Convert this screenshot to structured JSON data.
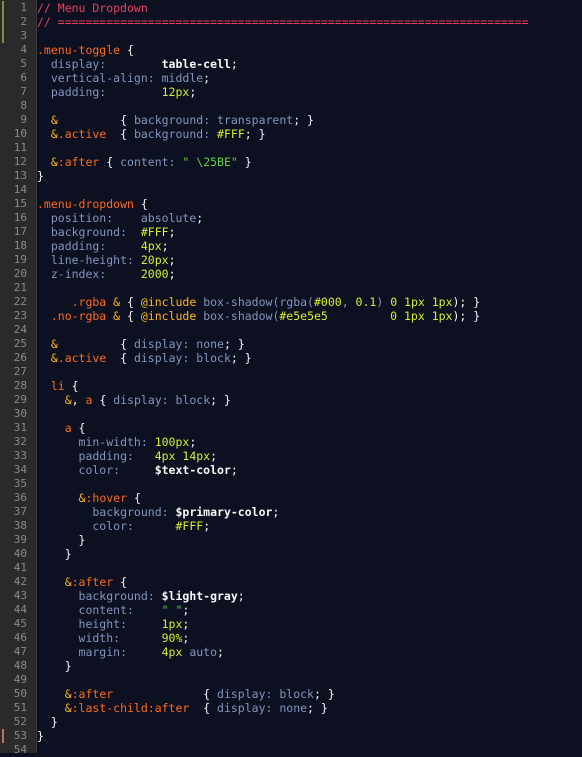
{
  "editor": {
    "gutter_markers": [
      {
        "from_line": 1,
        "to_line": 3,
        "color": "#8a8a3a"
      },
      {
        "from_line": 53,
        "to_line": 53,
        "color": "#c07050"
      }
    ],
    "line_count": 54,
    "lines": [
      [
        [
          "c",
          "// Menu Dropdown"
        ]
      ],
      [
        [
          "c",
          "// ===================================================================="
        ]
      ],
      [],
      [
        [
          "s",
          ".menu-toggle"
        ],
        [
          "w",
          " {"
        ]
      ],
      [
        [
          "p",
          "  display:        "
        ],
        [
          "k",
          "table-cell"
        ],
        [
          "w",
          ";"
        ]
      ],
      [
        [
          "p",
          "  vertical-align: middle"
        ],
        [
          "w",
          ";"
        ]
      ],
      [
        [
          "p",
          "  padding:        "
        ],
        [
          "n",
          "12px"
        ],
        [
          "w",
          ";"
        ]
      ],
      [],
      [
        [
          "a",
          "  &"
        ],
        [
          "w",
          "         { "
        ],
        [
          "p",
          "background: transparent"
        ],
        [
          "w",
          "; }"
        ]
      ],
      [
        [
          "a",
          "  &"
        ],
        [
          "s",
          ".active"
        ],
        [
          "w",
          "  { "
        ],
        [
          "p",
          "background: "
        ],
        [
          "n",
          "#FFF"
        ],
        [
          "w",
          "; }"
        ]
      ],
      [],
      [
        [
          "a",
          "  &"
        ],
        [
          "s",
          ":after"
        ],
        [
          "w",
          " { "
        ],
        [
          "p",
          "content: "
        ],
        [
          "str",
          "\" \\25BE\""
        ],
        [
          "w",
          " }"
        ]
      ],
      [
        [
          "w",
          "}"
        ]
      ],
      [],
      [
        [
          "s",
          ".menu-dropdown"
        ],
        [
          "w",
          " {"
        ]
      ],
      [
        [
          "p",
          "  position:    absolute"
        ],
        [
          "w",
          ";"
        ]
      ],
      [
        [
          "p",
          "  background:  "
        ],
        [
          "n",
          "#FFF"
        ],
        [
          "w",
          ";"
        ]
      ],
      [
        [
          "p",
          "  padding:     "
        ],
        [
          "n",
          "4px"
        ],
        [
          "w",
          ";"
        ]
      ],
      [
        [
          "p",
          "  line-height: "
        ],
        [
          "n",
          "20px"
        ],
        [
          "w",
          ";"
        ]
      ],
      [
        [
          "p",
          "  z-index:     "
        ],
        [
          "n",
          "2000"
        ],
        [
          "w",
          ";"
        ]
      ],
      [],
      [
        [
          "s",
          "     .rgba"
        ],
        [
          "a",
          " &"
        ],
        [
          "w",
          " { "
        ],
        [
          "a",
          "@include"
        ],
        [
          "p",
          " box-shadow(rgba("
        ],
        [
          "n",
          "#000"
        ],
        [
          "p",
          ", "
        ],
        [
          "n",
          "0.1"
        ],
        [
          "p",
          ") "
        ],
        [
          "n",
          "0 1px 1px"
        ],
        [
          "w",
          "); }"
        ]
      ],
      [
        [
          "s",
          "  .no-rgba"
        ],
        [
          "a",
          " &"
        ],
        [
          "w",
          " { "
        ],
        [
          "a",
          "@include"
        ],
        [
          "p",
          " box-shadow("
        ],
        [
          "n",
          "#e5e5e5"
        ],
        [
          "p",
          "         "
        ],
        [
          "n",
          "0 1px 1px"
        ],
        [
          "w",
          "); }"
        ]
      ],
      [],
      [
        [
          "a",
          "  &"
        ],
        [
          "w",
          "         { "
        ],
        [
          "p",
          "display: none"
        ],
        [
          "w",
          "; }"
        ]
      ],
      [
        [
          "a",
          "  &"
        ],
        [
          "s",
          ".active"
        ],
        [
          "w",
          "  { "
        ],
        [
          "p",
          "display: block"
        ],
        [
          "w",
          "; }"
        ]
      ],
      [],
      [
        [
          "s",
          "  li"
        ],
        [
          "w",
          " {"
        ]
      ],
      [
        [
          "a",
          "    &"
        ],
        [
          "w",
          ", "
        ],
        [
          "s",
          "a"
        ],
        [
          "w",
          " { "
        ],
        [
          "p",
          "display: block"
        ],
        [
          "w",
          "; }"
        ]
      ],
      [],
      [
        [
          "s",
          "    a"
        ],
        [
          "w",
          " {"
        ]
      ],
      [
        [
          "p",
          "      min-width: "
        ],
        [
          "n",
          "100px"
        ],
        [
          "w",
          ";"
        ]
      ],
      [
        [
          "p",
          "      padding:   "
        ],
        [
          "n",
          "4px 14px"
        ],
        [
          "w",
          ";"
        ]
      ],
      [
        [
          "p",
          "      color:     "
        ],
        [
          "k",
          "$text-color"
        ],
        [
          "w",
          ";"
        ]
      ],
      [],
      [
        [
          "a",
          "      &"
        ],
        [
          "s",
          ":hover"
        ],
        [
          "w",
          " {"
        ]
      ],
      [
        [
          "p",
          "        background: "
        ],
        [
          "k",
          "$primary-color"
        ],
        [
          "w",
          ";"
        ]
      ],
      [
        [
          "p",
          "        color:      "
        ],
        [
          "n",
          "#FFF"
        ],
        [
          "w",
          ";"
        ]
      ],
      [
        [
          "w",
          "      }"
        ]
      ],
      [
        [
          "w",
          "    }"
        ]
      ],
      [],
      [
        [
          "a",
          "    &"
        ],
        [
          "s",
          ":after"
        ],
        [
          "w",
          " {"
        ]
      ],
      [
        [
          "p",
          "      background: "
        ],
        [
          "k",
          "$light-gray"
        ],
        [
          "w",
          ";"
        ]
      ],
      [
        [
          "p",
          "      content:    "
        ],
        [
          "str",
          "\" \""
        ],
        [
          "w",
          ";"
        ]
      ],
      [
        [
          "p",
          "      height:     "
        ],
        [
          "n",
          "1px"
        ],
        [
          "w",
          ";"
        ]
      ],
      [
        [
          "p",
          "      width:      "
        ],
        [
          "n",
          "90%"
        ],
        [
          "w",
          ";"
        ]
      ],
      [
        [
          "p",
          "      margin:     "
        ],
        [
          "n",
          "4px"
        ],
        [
          "p",
          " auto"
        ],
        [
          "w",
          ";"
        ]
      ],
      [
        [
          "w",
          "    }"
        ]
      ],
      [],
      [
        [
          "a",
          "    &"
        ],
        [
          "s",
          ":after"
        ],
        [
          "w",
          "             { "
        ],
        [
          "p",
          "display: block"
        ],
        [
          "w",
          "; }"
        ]
      ],
      [
        [
          "a",
          "    &"
        ],
        [
          "s",
          ":last-child:after"
        ],
        [
          "w",
          "  { "
        ],
        [
          "p",
          "display: none"
        ],
        [
          "w",
          "; }"
        ]
      ],
      [
        [
          "w",
          "  }"
        ]
      ],
      [
        [
          "w",
          "}"
        ]
      ],
      []
    ]
  }
}
